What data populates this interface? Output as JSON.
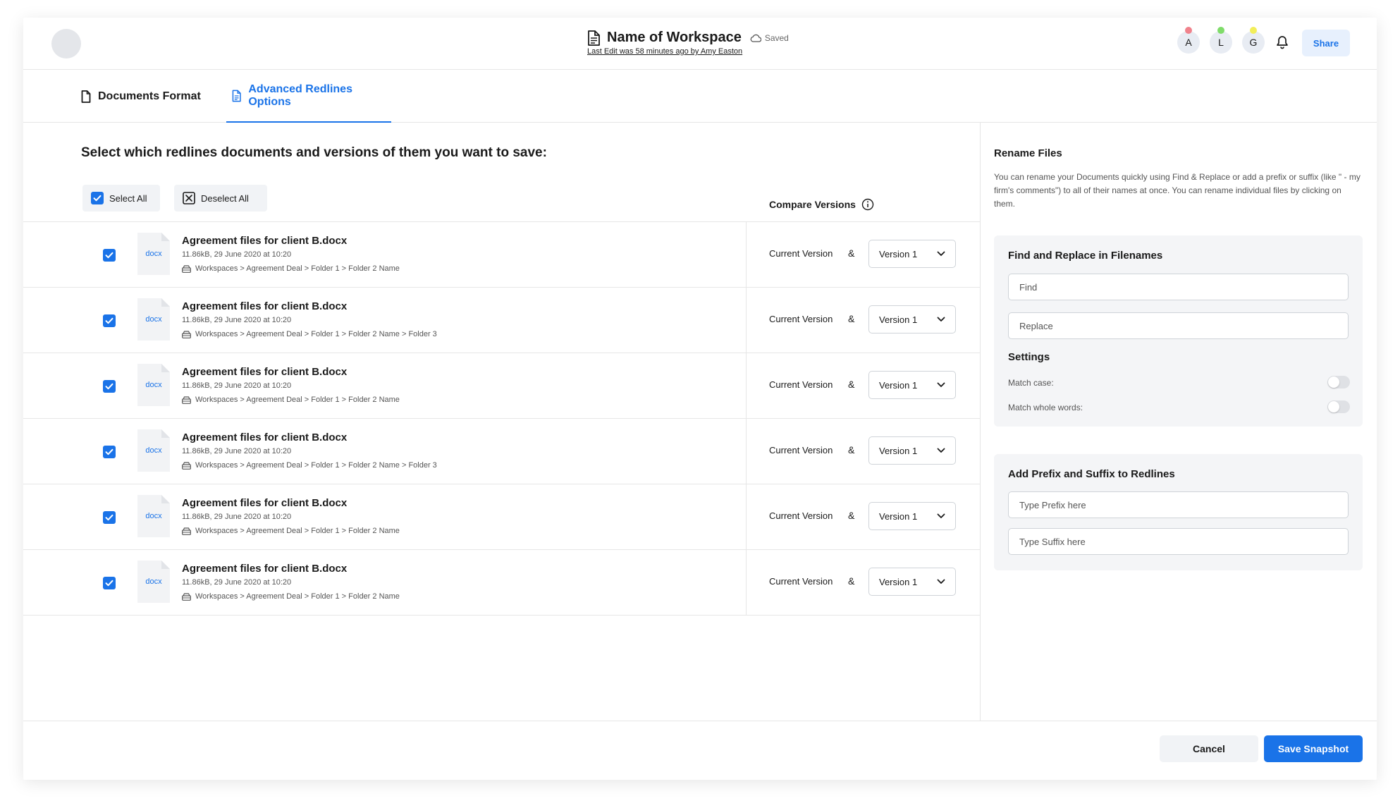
{
  "header": {
    "workspace_title": "Name of Workspace",
    "saved_label": "Saved",
    "last_edit": "Last Edit was 58 minutes ago by Amy Easton",
    "share_label": "Share",
    "avatars": [
      {
        "letter": "A",
        "dot_color": "#f0828c"
      },
      {
        "letter": "L",
        "dot_color": "#7fdc6a"
      },
      {
        "letter": "G",
        "dot_color": "#f2ee5a"
      }
    ]
  },
  "tabs": [
    {
      "label": "Documents Format",
      "active": false
    },
    {
      "label": "Advanced Redlines Options",
      "active": true
    }
  ],
  "main": {
    "heading": "Select which redlines documents and versions of them you want to save:",
    "select_all_label": "Select All",
    "deselect_all_label": "Deselect All",
    "compare_versions_label": "Compare Versions",
    "files": [
      {
        "name": "Agreement files for client B.docx",
        "meta": "11.86kB, 29 June 2020 at 10:20",
        "path": "Workspaces > Agreement Deal > Folder 1 > Folder 2 Name",
        "type": "docx",
        "checked": true,
        "current": "Current Version",
        "amp": "&",
        "version": "Version 1"
      },
      {
        "name": "Agreement files for client B.docx",
        "meta": "11.86kB, 29 June 2020 at 10:20",
        "path": "Workspaces > Agreement Deal > Folder 1 > Folder 2 Name > Folder 3",
        "type": "docx",
        "checked": true,
        "current": "Current Version",
        "amp": "&",
        "version": "Version 1"
      },
      {
        "name": "Agreement files for client B.docx",
        "meta": "11.86kB, 29 June 2020 at 10:20",
        "path": "Workspaces > Agreement Deal > Folder 1 > Folder 2 Name",
        "type": "docx",
        "checked": true,
        "current": "Current Version",
        "amp": "&",
        "version": "Version 1"
      },
      {
        "name": "Agreement files for client B.docx",
        "meta": "11.86kB, 29 June 2020 at 10:20",
        "path": "Workspaces > Agreement Deal > Folder 1 > Folder 2 Name > Folder 3",
        "type": "docx",
        "checked": true,
        "current": "Current Version",
        "amp": "&",
        "version": "Version 1"
      },
      {
        "name": "Agreement files for client B.docx",
        "meta": "11.86kB, 29 June 2020 at 10:20",
        "path": "Workspaces > Agreement Deal > Folder 1 > Folder 2 Name",
        "type": "docx",
        "checked": true,
        "current": "Current Version",
        "amp": "&",
        "version": "Version 1"
      },
      {
        "name": "Agreement files for client B.docx",
        "meta": "11.86kB, 29 June 2020 at 10:20",
        "path": "Workspaces > Agreement Deal > Folder 1 > Folder 2 Name",
        "type": "docx",
        "checked": true,
        "current": "Current Version",
        "amp": "&",
        "version": "Version 1"
      }
    ]
  },
  "rename": {
    "title": "Rename Files",
    "description": "You can rename your Documents quickly using Find & Replace or add a prefix or suffix (like \" - my firm's  comments\") to all of their names at once. You can rename individual files by clicking on them.",
    "find_replace_title": "Find and Replace in Filenames",
    "find_placeholder": "Find",
    "replace_placeholder": "Replace",
    "settings_title": "Settings",
    "match_case_label": "Match case:",
    "match_whole_label": "Match whole words:",
    "prefix_suffix_title": "Add Prefix and Suffix to Redlines",
    "prefix_placeholder": "Type Prefix here",
    "suffix_placeholder": "Type Suffix here"
  },
  "footer": {
    "cancel_label": "Cancel",
    "save_label": "Save Snapshot"
  },
  "colors": {
    "accent": "#1a73e8",
    "accent_light": "#e7f0fd",
    "panel_bg": "#f4f5f7"
  }
}
